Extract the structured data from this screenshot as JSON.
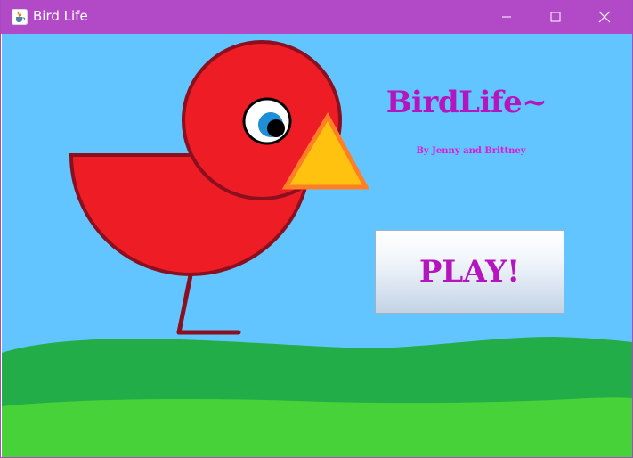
{
  "window": {
    "title": "Bird Life",
    "icon": "java-cup-icon",
    "controls": {
      "minimize": "minimize-icon",
      "maximize": "maximize-icon",
      "close": "close-icon"
    }
  },
  "menu": {
    "title": "BirdLife~",
    "credits": "By Jenny and Brittney",
    "play_label": "PLAY!"
  },
  "colors": {
    "titlebar": "#b24ac7",
    "sky": "#63c5ff",
    "grass_back": "#23ad48",
    "grass_front": "#47d23a",
    "bird_body": "#ee1c25",
    "bird_outline": "#8a0f1f",
    "beak_fill": "#ffc20e",
    "beak_outline": "#ff7f27",
    "title_text": "#b515bf"
  }
}
